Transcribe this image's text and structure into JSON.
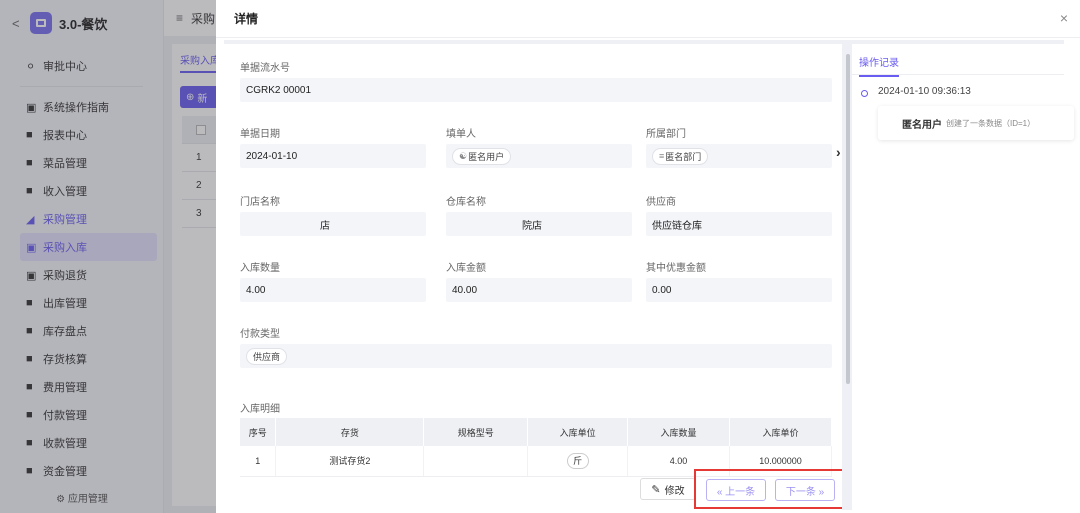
{
  "sidebar": {
    "app_title": "3.0-餐饮",
    "items": [
      {
        "label": "审批中心"
      },
      {
        "label": "系统操作指南"
      },
      {
        "label": "报表中心"
      },
      {
        "label": "菜品管理"
      },
      {
        "label": "收入管理"
      },
      {
        "label": "采购管理"
      },
      {
        "label": "采购入库"
      },
      {
        "label": "采购退货"
      },
      {
        "label": "出库管理"
      },
      {
        "label": "库存盘点"
      },
      {
        "label": "存货核算"
      },
      {
        "label": "费用管理"
      },
      {
        "label": "付款管理"
      },
      {
        "label": "收款管理"
      },
      {
        "label": "资金管理"
      }
    ],
    "footer": "应用管理"
  },
  "background": {
    "breadcrumb": "采购",
    "tab": "采购入库",
    "new_button": "新",
    "rows": [
      "1",
      "2",
      "3"
    ]
  },
  "drawer": {
    "title": "详情",
    "close": "×",
    "fields": {
      "serial": {
        "label": "单据流水号",
        "value": "CGRK2      00001"
      },
      "date": {
        "label": "单据日期",
        "value": "2024-01-10"
      },
      "filler": {
        "label": "填单人",
        "value": "匿名用户"
      },
      "dept": {
        "label": "所属部门",
        "value": "匿名部门"
      },
      "store": {
        "label": "门店名称",
        "value": "店"
      },
      "warehouse": {
        "label": "仓库名称",
        "value": "院店"
      },
      "supplier": {
        "label": "供应商",
        "value": "供应链仓库"
      },
      "qty": {
        "label": "入库数量",
        "value": "4.00"
      },
      "amount": {
        "label": "入库金额",
        "value": "40.00"
      },
      "discount": {
        "label": "其中优惠金额",
        "value": "0.00"
      },
      "pay_type": {
        "label": "付款类型",
        "value": "供应商"
      }
    },
    "detail": {
      "title": "入库明细",
      "columns": [
        "序号",
        "存货",
        "规格型号",
        "入库单位",
        "入库数量",
        "入库单价"
      ],
      "rows": [
        {
          "no": "1",
          "item": "测试存货2",
          "spec": "",
          "unit": "斤",
          "qty": "4.00",
          "price": "10.000000"
        }
      ]
    },
    "buttons": {
      "edit": "修改",
      "prev": "« 上一条",
      "next": "下一条 »"
    },
    "history": {
      "tab": "操作记录",
      "time": "2024-01-10 09:36:13",
      "user": "匿名用户",
      "action": "创建了一条数据（ID=1）"
    }
  },
  "colors": {
    "accent": "#6a5cf0",
    "highlight": "#e53935"
  }
}
